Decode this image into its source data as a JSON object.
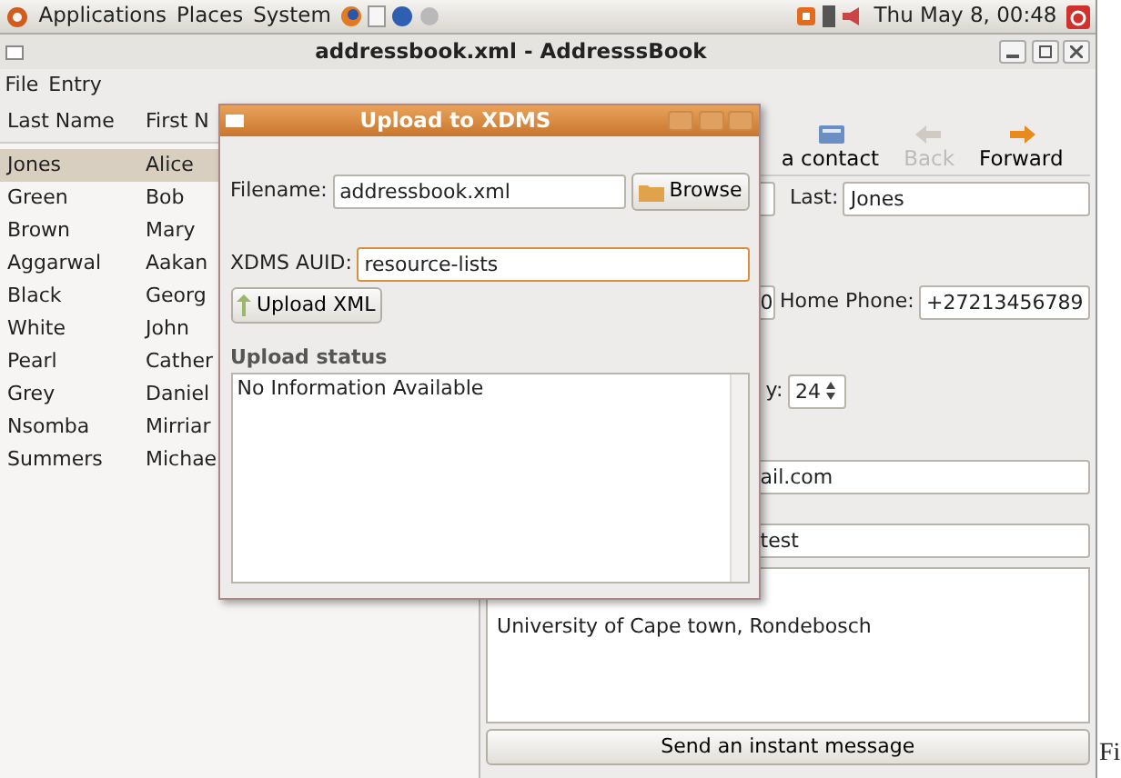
{
  "top_panel": {
    "menus": [
      "Applications",
      "Places",
      "System"
    ],
    "clock": "Thu May  8, 00:48"
  },
  "window": {
    "title": "addressbook.xml - AddresssBook",
    "menu": [
      "File",
      "Entry"
    ]
  },
  "contact_list": {
    "columns": [
      "Last Name",
      "First N"
    ],
    "rows": [
      {
        "last": "Jones",
        "first": "Alice",
        "selected": true
      },
      {
        "last": "Green",
        "first": "Bob",
        "selected": false
      },
      {
        "last": "Brown",
        "first": "Mary",
        "selected": false
      },
      {
        "last": "Aggarwal",
        "first": "Aakan",
        "selected": false
      },
      {
        "last": "Black",
        "first": "Georg",
        "selected": false
      },
      {
        "last": "White",
        "first": "John",
        "selected": false
      },
      {
        "last": "Pearl",
        "first": "Cather",
        "selected": false
      },
      {
        "last": "Grey",
        "first": "Daniel",
        "selected": false
      },
      {
        "last": "Nsomba",
        "first": "Mirriar",
        "selected": false
      },
      {
        "last": "Summers",
        "first": "Michae",
        "selected": false
      }
    ]
  },
  "toolbar": [
    {
      "kind": "contact",
      "label": "a contact",
      "disabled": false
    },
    {
      "kind": "back",
      "label": "Back",
      "disabled": true
    },
    {
      "kind": "forward",
      "label": "Forward",
      "disabled": false
    }
  ],
  "details": {
    "last_label": "Last:",
    "last_name": "Jones",
    "phone_1": "0",
    "home_phone_label": "Home Phone:",
    "home_phone": "+27213456789",
    "spin_label": "y:",
    "spin_value": "24",
    "email": "ail.com",
    "field_5": "test",
    "address": "University of Cape town, Rondebosch"
  },
  "send_button": "Send an instant message",
  "dialog": {
    "title": "Upload to XDMS",
    "filename_label": "Filename:",
    "filename": "addressbook.xml",
    "browse": "Browse",
    "auid_label": "XDMS AUID:",
    "auid": "resource-lists",
    "upload": "Upload XML",
    "status_heading": "Upload status",
    "status_text": "No Information Available"
  },
  "caption": "Fi"
}
